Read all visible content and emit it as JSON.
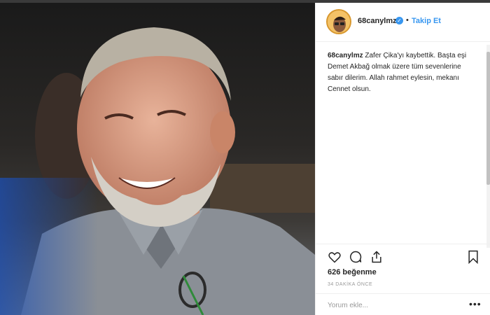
{
  "post": {
    "username": "68canylmz",
    "verified_icon": "verified-badge-icon",
    "separator": "•",
    "follow_label": "Takip Et",
    "caption_user": "68canylmz",
    "caption_text": "Zafer Çika'yı kaybettik. Başta eşi Demet Akbağ olmak üzere tüm sevenlerine sabır dilerim. Allah rahmet eylesin, mekanı Cennet olsun.",
    "likes": "626 beğenme",
    "time": "34 DAKİKA ÖNCE",
    "comment_placeholder": "Yorum ekle...",
    "more_label": "•••"
  },
  "icons": {
    "like": "heart-icon",
    "comment": "comment-icon",
    "share": "share-icon",
    "save": "bookmark-icon"
  },
  "colors": {
    "link_blue": "#3897f0",
    "text": "#262626",
    "muted": "#999999",
    "border": "#efefef"
  }
}
